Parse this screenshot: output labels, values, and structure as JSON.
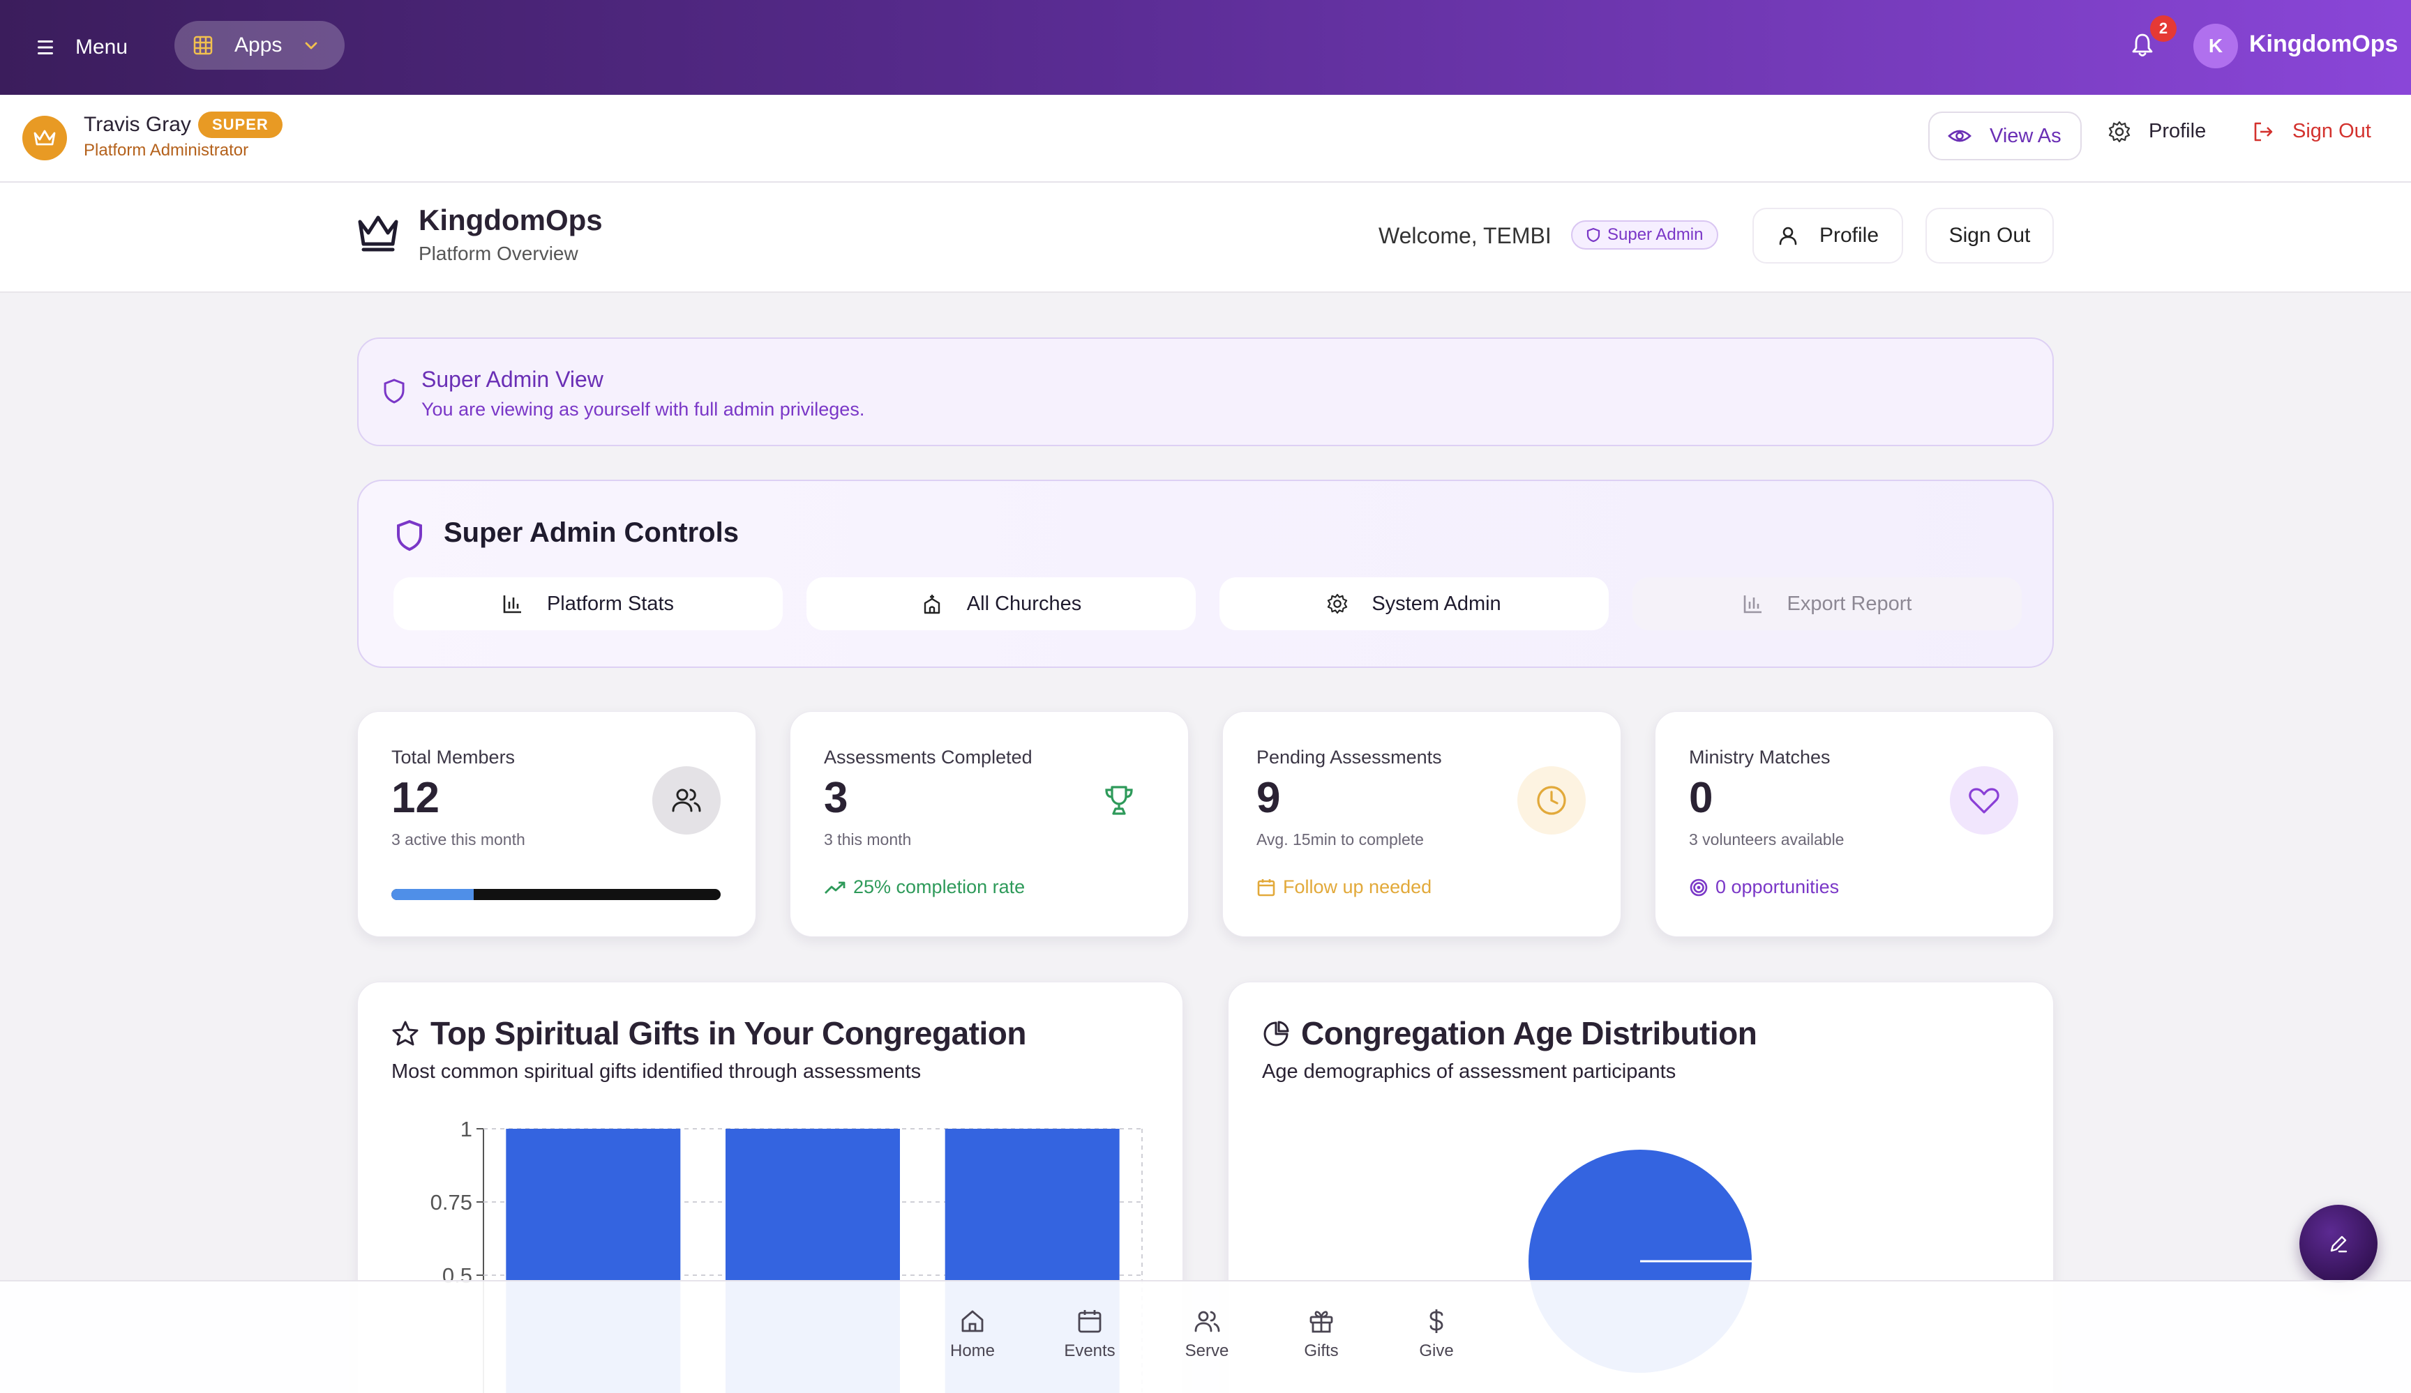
{
  "topbar": {
    "menu_label": "Menu",
    "apps_label": "Apps",
    "notification_count": "2",
    "avatar_initial": "K",
    "brand": "KingdomOps"
  },
  "userbar": {
    "name": "Travis Gray",
    "badge": "SUPER",
    "role": "Platform Administrator",
    "view_as": "View As",
    "profile": "Profile",
    "sign_out": "Sign Out"
  },
  "header": {
    "title": "KingdomOps",
    "subtitle": "Platform Overview",
    "welcome": "Welcome, TEMBI",
    "role_badge": "Super Admin",
    "profile": "Profile",
    "sign_out": "Sign Out"
  },
  "banner": {
    "title": "Super Admin View",
    "text": "You are viewing as yourself with full admin privileges."
  },
  "controls": {
    "title": "Super Admin Controls",
    "buttons": [
      "Platform Stats",
      "All Churches",
      "System Admin",
      "Export Report"
    ]
  },
  "stats": [
    {
      "label": "Total Members",
      "value": "12",
      "sub": "3 active this month",
      "progress": 0.25
    },
    {
      "label": "Assessments Completed",
      "value": "3",
      "sub": "3 this month",
      "foot": "25% completion rate"
    },
    {
      "label": "Pending Assessments",
      "value": "9",
      "sub": "Avg. 15min to complete",
      "foot": "Follow up needed"
    },
    {
      "label": "Ministry Matches",
      "value": "0",
      "sub": "3 volunteers available",
      "foot": "0 opportunities"
    }
  ],
  "colors": {
    "accent": "#6a2fb5",
    "green": "#2e9a5a",
    "amber": "#e2a93a",
    "purple": "#7a37c7",
    "bar": "#3464e0"
  },
  "gifts_panel": {
    "title": "Top Spiritual Gifts in Your Congregation",
    "subtitle": "Most common spiritual gifts identified through assessments"
  },
  "age_panel": {
    "title": "Congregation Age Distribution",
    "subtitle": "Age demographics of assessment participants"
  },
  "chart_data": [
    {
      "type": "bar",
      "title": "Top Spiritual Gifts in Your Congregation",
      "categories": [
        "",
        "",
        ""
      ],
      "values": [
        1,
        1,
        1
      ],
      "yticks": [
        "1",
        "0.75",
        "0.5"
      ],
      "ylim": [
        0,
        1
      ],
      "grid": true
    },
    {
      "type": "pie",
      "title": "Congregation Age Distribution",
      "values": [
        1
      ]
    }
  ],
  "nav": [
    "Home",
    "Events",
    "Serve",
    "Gifts",
    "Give"
  ]
}
